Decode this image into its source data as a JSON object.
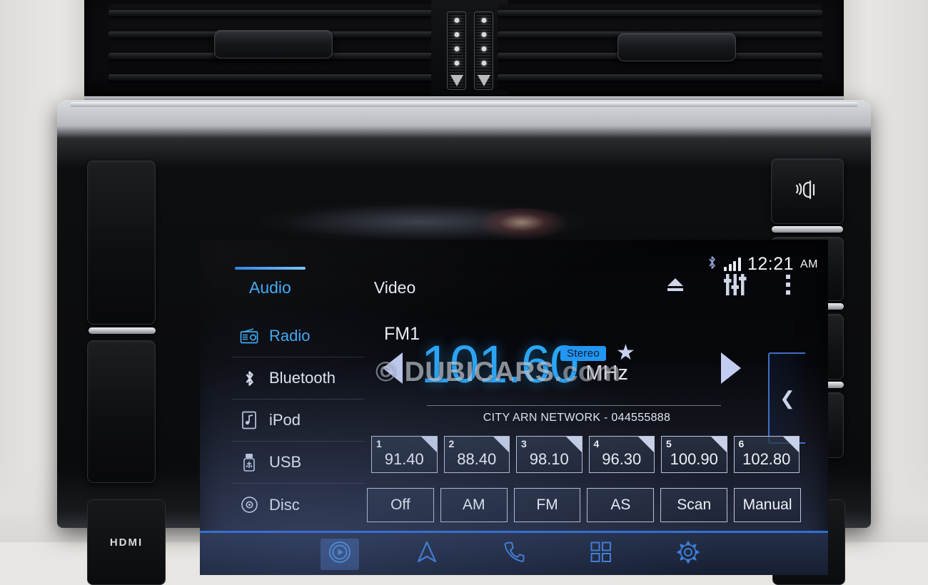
{
  "status_bar": {
    "bluetooth_icon": "bluetooth-icon",
    "signal_icon": "signal-bars-icon",
    "signal_strength": 4,
    "time": "12:21",
    "ampm": "AM"
  },
  "tabs": [
    {
      "label": "Audio",
      "active": true
    },
    {
      "label": "Video",
      "active": false
    }
  ],
  "top_actions": [
    {
      "name": "eject-icon",
      "label": "Eject"
    },
    {
      "name": "equalizer-icon",
      "label": "Sound Settings"
    },
    {
      "name": "more-options-icon",
      "label": "More"
    }
  ],
  "sources": [
    {
      "label": "Radio",
      "icon": "radio-icon",
      "active": true
    },
    {
      "label": "Bluetooth",
      "icon": "bluetooth-icon",
      "active": false
    },
    {
      "label": "iPod",
      "icon": "ipod-icon",
      "active": false
    },
    {
      "label": "USB",
      "icon": "usb-icon",
      "active": false
    },
    {
      "label": "Disc",
      "icon": "disc-icon",
      "active": false
    }
  ],
  "now_playing": {
    "band": "FM1",
    "frequency": "101.60",
    "unit": "MHz",
    "stereo_badge": "Stereo",
    "favorite_icon": "star-icon",
    "station_text": "CITY ARN NETWORK - 044555888",
    "prev_icon": "previous-station-icon",
    "next_icon": "next-station-icon"
  },
  "panel_handle": {
    "icon": "chevron-left-icon"
  },
  "presets": [
    {
      "num": "1",
      "value": "91.40"
    },
    {
      "num": "2",
      "value": "88.40"
    },
    {
      "num": "3",
      "value": "98.10"
    },
    {
      "num": "4",
      "value": "96.30"
    },
    {
      "num": "5",
      "value": "100.90"
    },
    {
      "num": "6",
      "value": "102.80"
    }
  ],
  "modes": [
    {
      "label": "Off"
    },
    {
      "label": "AM"
    },
    {
      "label": "FM"
    },
    {
      "label": "AS"
    },
    {
      "label": "Scan"
    },
    {
      "label": "Manual"
    }
  ],
  "bottom_nav": [
    {
      "name": "media-icon",
      "active": true
    },
    {
      "name": "navigation-icon",
      "active": false
    },
    {
      "name": "phone-icon",
      "active": false
    },
    {
      "name": "apps-icon",
      "active": false
    },
    {
      "name": "settings-gear-icon",
      "active": false
    }
  ],
  "hardware": {
    "voice_button": "voice-command-icon",
    "back_button": "back-home-icon",
    "volume_up": "+",
    "volume_down": "−",
    "hdmi_label": "HDMI",
    "usb_port_icon": "usb-port-icon"
  },
  "watermark": {
    "symbol": "©",
    "text": "DUBICARS",
    "suffix": ".com"
  },
  "colors": {
    "accent_cyan": "#2aa6f7",
    "badge_blue": "#2196f3",
    "screen_text": "#eef2f8",
    "nav_blue": "#3f7fd8"
  }
}
